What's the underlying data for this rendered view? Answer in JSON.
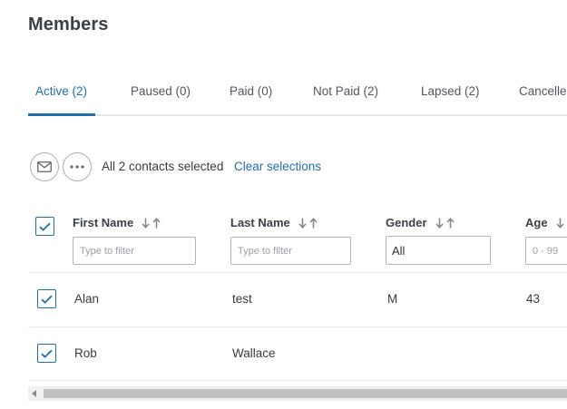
{
  "page": {
    "title": "Members"
  },
  "tabs": [
    {
      "label": "Active (2)",
      "active": true
    },
    {
      "label": "Paused (0)"
    },
    {
      "label": "Paid (0)"
    },
    {
      "label": "Not Paid (2)"
    },
    {
      "label": "Lapsed (2)"
    },
    {
      "label": "Cancelled"
    }
  ],
  "actions": {
    "email_icon": "envelope-icon",
    "more_icon": "more-dots-icon",
    "selection_text": "All 2 contacts selected",
    "clear_label": "Clear selections"
  },
  "table": {
    "columns": [
      {
        "label": "First Name",
        "filter_placeholder": "Type to filter"
      },
      {
        "label": "Last Name",
        "filter_placeholder": "Type to filter"
      },
      {
        "label": "Gender",
        "filter_value": "All"
      },
      {
        "label": "Age",
        "filter_placeholder": "0 - 99"
      }
    ],
    "rows": [
      {
        "first_name": "Alan",
        "last_name": "test",
        "gender": "M",
        "age": "43",
        "checked": true
      },
      {
        "first_name": "Rob",
        "last_name": "Wallace",
        "gender": "",
        "age": "",
        "checked": true
      }
    ]
  },
  "colors": {
    "accent": "#1f6fae",
    "text": "#353b41",
    "border": "#aeb4ba"
  }
}
